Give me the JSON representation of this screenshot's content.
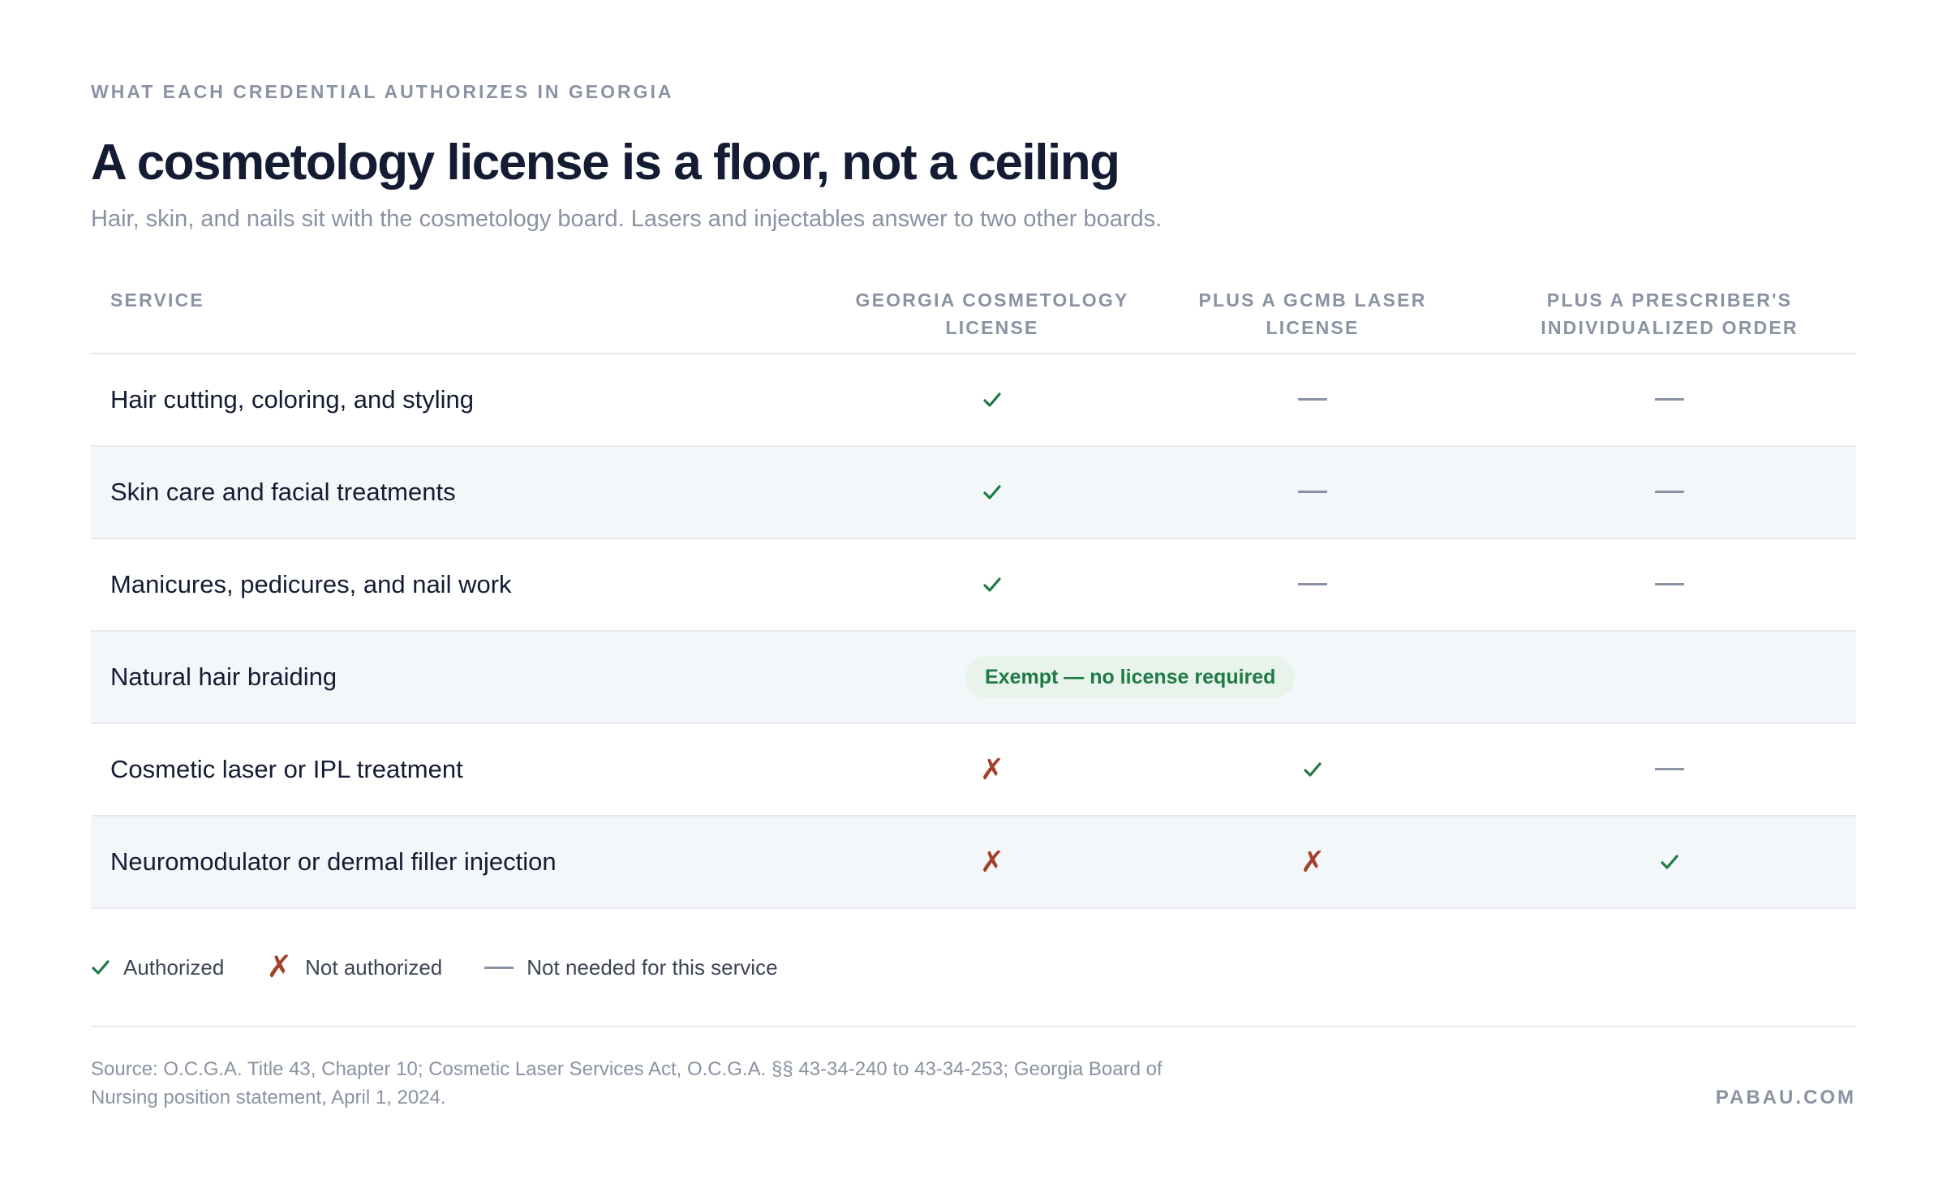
{
  "eyebrow": "WHAT EACH CREDENTIAL AUTHORIZES IN GEORGIA",
  "title": "A cosmetology license is a floor, not a ceiling",
  "subtitle": "Hair, skin, and nails sit with the cosmetology board. Lasers and injectables answer to two other boards.",
  "table": {
    "headers": {
      "service": "SERVICE",
      "col1": "GEORGIA COSMETOLOGY LICENSE",
      "col2": "PLUS A GCMB LASER LICENSE",
      "col3": "PLUS A PRESCRIBER'S INDIVIDUALIZED ORDER"
    },
    "rows": [
      {
        "service": "Hair cutting, coloring, and styling",
        "cells": [
          "check",
          "dash",
          "dash"
        ]
      },
      {
        "service": "Skin care and facial treatments",
        "cells": [
          "check",
          "dash",
          "dash"
        ]
      },
      {
        "service": "Manicures, pedicures, and nail work",
        "cells": [
          "check",
          "dash",
          "dash"
        ]
      },
      {
        "service": "Natural hair braiding",
        "exempt_label": "Exempt — no license required"
      },
      {
        "service": "Cosmetic laser or IPL treatment",
        "cells": [
          "cross",
          "check",
          "dash"
        ]
      },
      {
        "service": "Neuromodulator or dermal filler injection",
        "cells": [
          "cross",
          "cross",
          "check"
        ]
      }
    ]
  },
  "legend": {
    "authorized": "Authorized",
    "not_authorized": "Not authorized",
    "not_needed": "Not needed for this service"
  },
  "symbols": {
    "cross": "✗"
  },
  "colors": {
    "check": "#1f7a43",
    "cross": "#a3422b",
    "dash": "#8a93a3",
    "alt_row": "#f4f7fa"
  },
  "footer": {
    "source": "Source: O.C.G.A. Title 43, Chapter 10; Cosmetic Laser Services Act, O.C.G.A. §§ 43-34-240 to 43-34-253; Georgia Board of Nursing position statement, April 1, 2024.",
    "brand": "PABAU.COM"
  }
}
